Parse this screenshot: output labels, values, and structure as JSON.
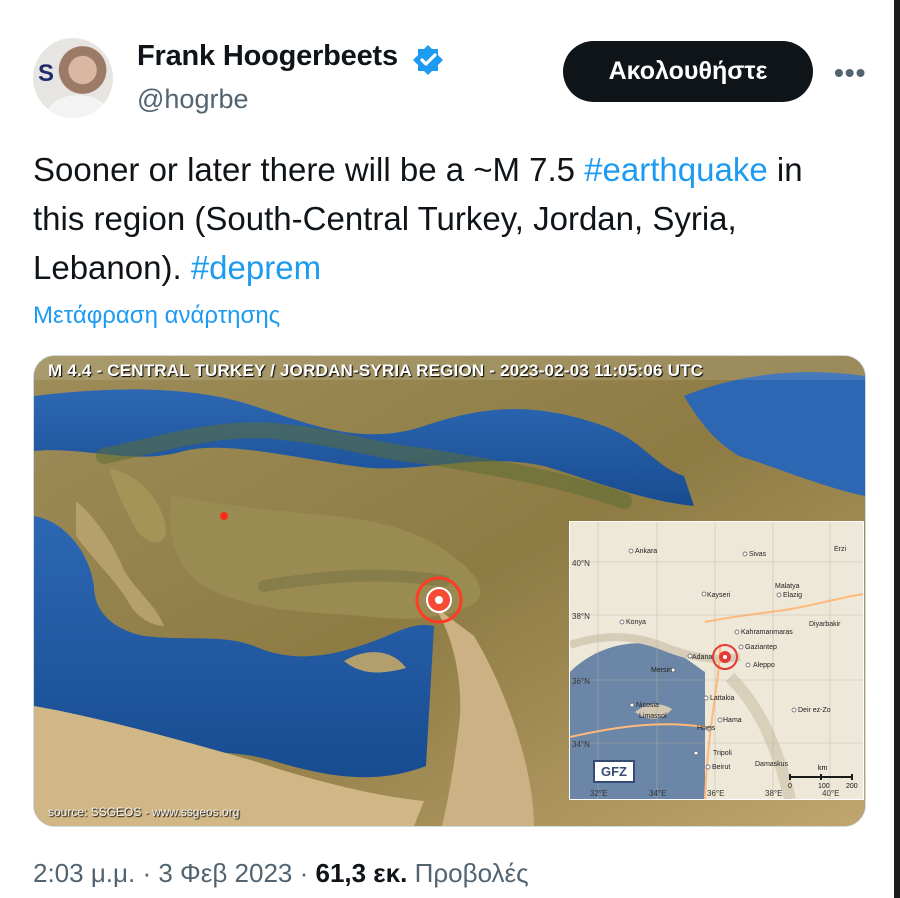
{
  "author": {
    "display_name": "Frank Hoogerbeets",
    "handle": "@hogrbe",
    "avatar_logo_text": "S",
    "verified_icon": "verified-badge-icon"
  },
  "actions": {
    "follow_label": "Ακολουθήστε",
    "more_label": "•••"
  },
  "tweet": {
    "text_1": "Sooner or later there will be a ~M 7.5 ",
    "hashtag_1": "#earthquake",
    "text_2": " in this region (South-Central Turkey, Jordan, Syria, Lebanon). ",
    "hashtag_2": "#deprem",
    "translate_label": "Μετάφραση ανάρτησης"
  },
  "media": {
    "title": "M 4.4 - CENTRAL TURKEY / JORDAN-SYRIA REGION - 2023-02-03 11:05:06 UTC",
    "source": "source: SSGEOS - www.ssgeos.org",
    "inset": {
      "gfz_label": "GFZ",
      "latitudes": [
        "40°N",
        "38°N",
        "36°N",
        "34°N"
      ],
      "longitudes": [
        "32°E",
        "34°E",
        "36°E",
        "38°E",
        "40°E"
      ],
      "cities": [
        "Ankara",
        "Sivas",
        "Erzi",
        "Kayseri",
        "Elazig",
        "Malatya",
        "Konya",
        "Kahramanmaras",
        "Diyarbakir",
        "Gaziantep",
        "Adana",
        "Mersin",
        "Aleppo",
        "Nicosia",
        "Limassol",
        "Lattakia",
        "Hama",
        "Homs",
        "Deir ez-Zo",
        "Tripoli",
        "Beirut",
        "Damaskus"
      ],
      "scale_unit": "km",
      "scale_labels": [
        "0",
        "100",
        "200"
      ]
    }
  },
  "footer": {
    "time_date": "2:03 μ.μ. · 3 Φεβ 2023 · ",
    "views_count": "61,3 εκ.",
    "views_label": " Προβολές"
  },
  "colors": {
    "accent": "#1d9bf0",
    "text": "#0f1419",
    "secondary": "#536471",
    "follow_button": "#0f1419",
    "earthquake_marker": "#e53935"
  }
}
